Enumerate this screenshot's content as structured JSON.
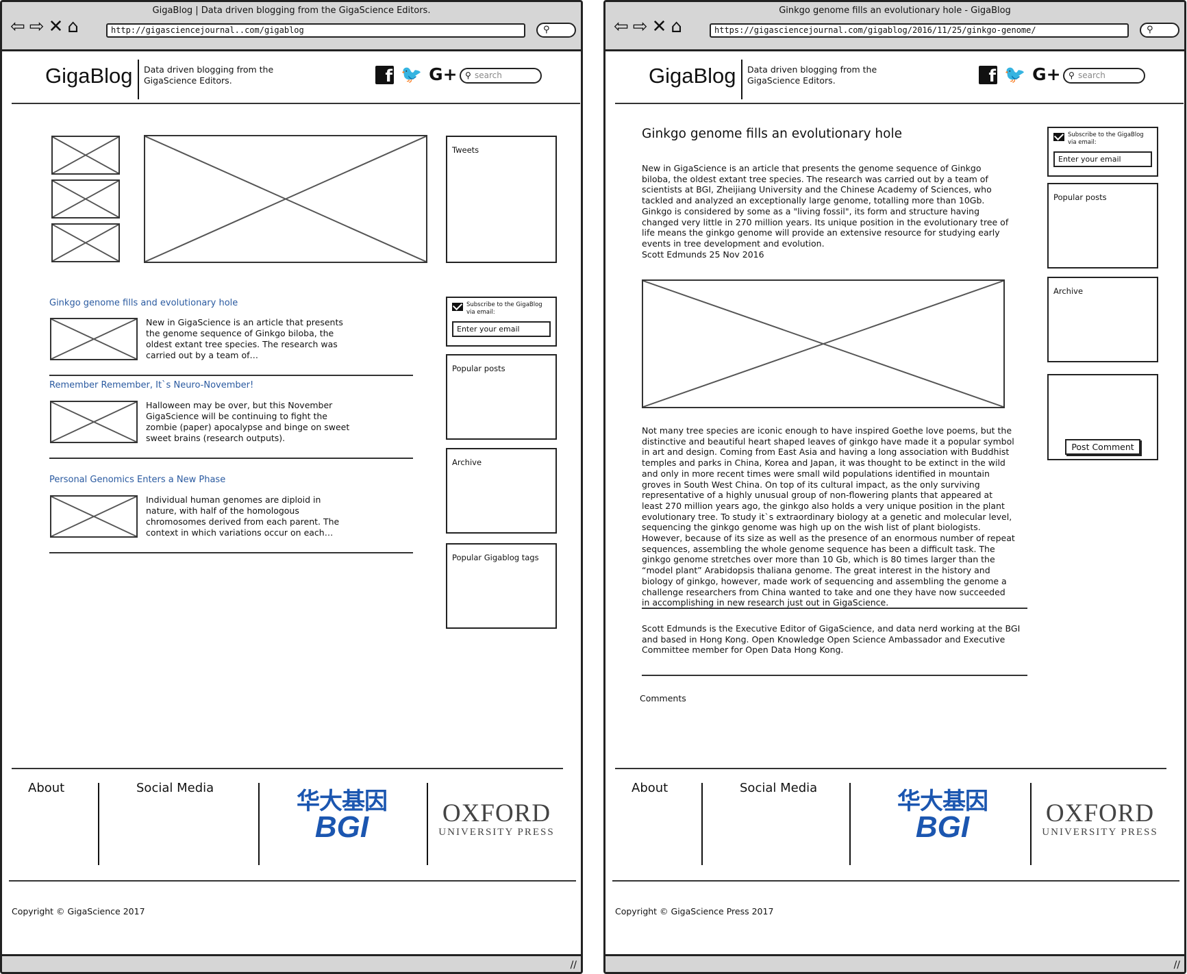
{
  "left": {
    "window_title": "GigaBlog | Data driven blogging from the GigaScience Editors.",
    "url": "http://gigasciencejournal..com/gigablog",
    "posts": [
      {
        "title": "Ginkgo genome fills and evolutionary hole",
        "excerpt": "New in GigaScience is an article that presents the genome sequence of Ginkgo biloba, the oldest extant tree species. The research was carried out by a team of…"
      },
      {
        "title": "Remember Remember, It`s Neuro-November!",
        "excerpt": "Halloween may be over, but this November GigaScience will be continuing to fight the zombie (paper) apocalypse and binge on sweet sweet brains (research outputs)."
      },
      {
        "title": "Personal Genomics Enters a New Phase",
        "excerpt": "Individual human genomes are diploid in nature, with half of the homologous chromosomes derived from each parent. The context in which variations occur on each…"
      }
    ],
    "sidebar": {
      "tweets": "Tweets",
      "popular_posts": "Popular posts",
      "archive": "Archive",
      "tags": "Popular Gigablog tags"
    },
    "copyright": "Copyright © GigaScience 2017"
  },
  "right": {
    "window_title": "Ginkgo genome fills an evolutionary hole - GigaBlog",
    "url": "https://gigasciencejournal.com/gigablog/2016/11/25/ginkgo-genome/",
    "article": {
      "title": "Ginkgo genome fills an evolutionary hole",
      "intro": "New in GigaScience is an article that presents the genome sequence of Ginkgo biloba, the oldest extant tree species. The research was carried out by a team of scientists at BGI, Zheijiang University and the Chinese Academy of Sciences, who tackled and analyzed an exceptionally large genome, totalling more than 10Gb. Ginkgo is considered by some as a \"living fossil\", its form and structure having changed very little in 270 million years. Its unique position in the evolutionary tree of life means the ginkgo genome will provide an extensive resource for studying early events in tree development and evolution.",
      "byline": "Scott Edmunds 25 Nov 2016",
      "body": "Not many tree species are iconic enough to have inspired Goethe love poems, but the distinctive and beautiful heart shaped leaves of ginkgo have made it a popular symbol in art and design. Coming from East Asia and having a long association with Buddhist temples and parks in China, Korea and Japan, it was thought to be extinct in the wild and only in more recent times were small wild populations identified in mountain groves in South West China. On top of its cultural impact, as the only surviving representative of a highly unusual group of non-flowering plants that appeared at least 270 million years ago, the ginkgo also holds a very unique position in the plant evolutionary tree. To study it`s extraordinary biology at a genetic and molecular level, sequencing the ginkgo genome was high up on the wish list of plant biologists. However, because of its size as well as the presence of an enormous number of repeat sequences, assembling the whole genome sequence has been a difficult task. The ginkgo genome stretches over more than 10 Gb, which is 80 times larger than the “model plant” Arabidopsis thaliana genome. The great interest in the history and biology of ginkgo, however, made work of sequencing and assembling the genome a challenge researchers from China wanted to take and one they have now succeeded in accomplishing in new research  just out in GigaScience.",
      "author_bio": "Scott Edmunds is the Executive Editor of GigaScience, and data nerd working at the BGI and based in Hong Kong. Open Knowledge Open Science Ambassador and Executive Committee member for Open Data Hong Kong.",
      "comments_label": "Comments"
    },
    "sidebar": {
      "popular_posts": "Popular posts",
      "archive": "Archive",
      "post_comment": "Post Comment"
    },
    "copyright": "Copyright © GigaScience Press 2017"
  },
  "common": {
    "logo": "GigaBlog",
    "tagline": "Data driven blogging from the GigaScience Editors.",
    "search_placeholder": "search",
    "chrome_search_icon": "magnifier-icon",
    "subscribe_text": "Subscribe to the GigaBlog via email:",
    "email_placeholder": "Enter your email",
    "footer_about": "About",
    "footer_social": "Social Media",
    "bgi_zh": "华大基因",
    "bgi_en": "BGI",
    "oup_line1": "OXFORD",
    "oup_line2": "UNIVERSITY PRESS",
    "social_icons": [
      "facebook-icon",
      "twitter-icon",
      "google-plus-icon"
    ],
    "brand_blue": "#1b56b0",
    "link_blue": "#2a5aa0"
  }
}
